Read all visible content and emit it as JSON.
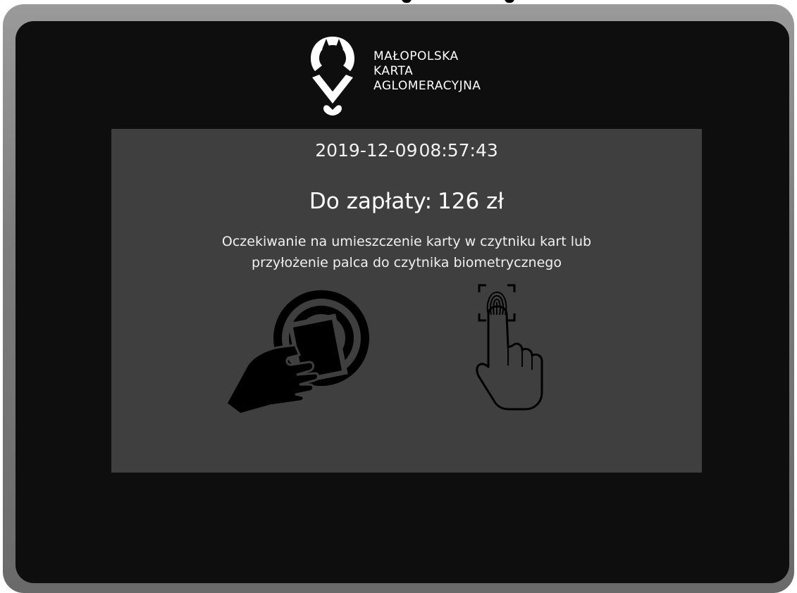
{
  "logo": {
    "line1": "MAŁOPOLSKA",
    "line2": "KARTA",
    "line3": "AGLOMERACYJNA"
  },
  "status": {
    "date": "2019-12-09",
    "time": "08:57:43"
  },
  "payment": {
    "label": "Do zapłaty:",
    "amount": "126 zł"
  },
  "message": {
    "line1": "Oczekiwanie na umieszczenie karty w czytniku kart lub",
    "line2": "przyłożenie palca do czytnika biometrycznego"
  },
  "icons": {
    "logo": "map-pin-logo-icon",
    "card": "contactless-card-icon",
    "fingerprint": "fingerprint-touch-icon"
  },
  "colors": {
    "bezel": "#7d7d7d",
    "screen_background": "#0e0e0e",
    "panel_background": "#3f3f3f",
    "text": "#ffffff",
    "icon": "#000000"
  }
}
